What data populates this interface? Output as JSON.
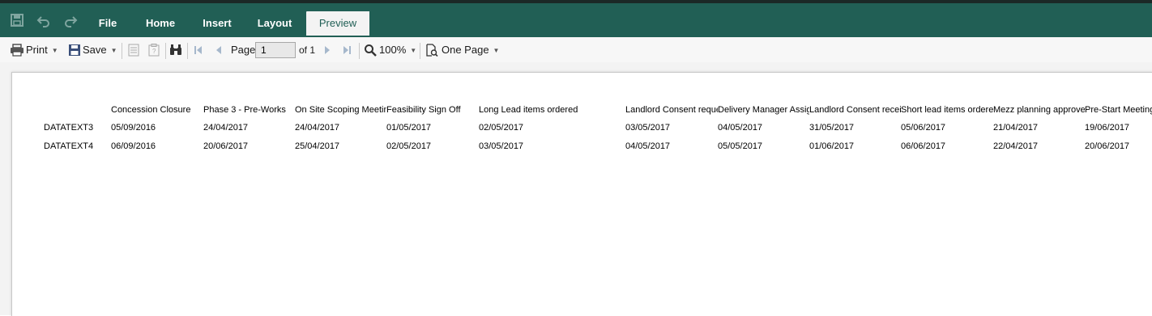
{
  "ribbon": {
    "tabs": [
      {
        "label": "File"
      },
      {
        "label": "Home"
      },
      {
        "label": "Insert"
      },
      {
        "label": "Layout"
      },
      {
        "label": "Preview"
      }
    ],
    "active_tab": "Preview",
    "color": "#215f55"
  },
  "quick_access": {
    "icons": [
      "save-icon",
      "undo-icon",
      "redo-icon"
    ]
  },
  "toolbar": {
    "print_label": "Print",
    "save_label": "Save",
    "page_label": "Page",
    "page_value": "1",
    "of_label": "of 1",
    "zoom_value": "100%",
    "view_mode": "One Page"
  },
  "report": {
    "headers": [
      "Concession Closure",
      "Phase 3 - Pre-Works",
      "On Site Scoping Meeting",
      "Feasibility Sign Off",
      "Long Lead items ordered",
      "Landlord Consent requested",
      "Delivery Manager Assigned",
      "Landlord Consent received",
      "Short lead items ordered",
      "Mezz planning approved",
      "Pre-Start Meeting"
    ],
    "rows": [
      {
        "label": "DATATEXT3",
        "values": [
          "05/09/2016",
          "24/04/2017",
          "24/04/2017",
          "01/05/2017",
          "02/05/2017",
          "03/05/2017",
          "04/05/2017",
          "31/05/2017",
          "05/06/2017",
          "21/04/2017",
          "19/06/2017"
        ]
      },
      {
        "label": "DATATEXT4",
        "values": [
          "06/09/2016",
          "20/06/2017",
          "25/04/2017",
          "02/05/2017",
          "03/05/2017",
          "04/05/2017",
          "05/05/2017",
          "01/06/2017",
          "06/06/2017",
          "22/04/2017",
          "20/06/2017"
        ]
      }
    ]
  }
}
